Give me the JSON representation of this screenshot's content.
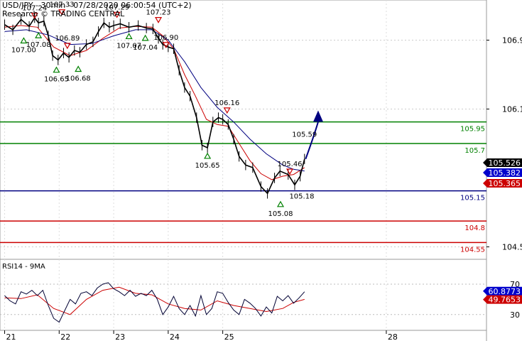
{
  "header": {
    "line1": "USD/JPY - 30min - 07/28/2020 06:00:54 (UTC+2)",
    "line2": "Research © TRADING CENTRAL"
  },
  "chart_data": [
    {
      "type": "line",
      "title": "USD/JPY - 30min - 07/28/2020 06:00:54 (UTC+2)",
      "price_axis": {
        "range": [
          104.38,
          107.3
        ],
        "ticks": [
          "106.9",
          "106.1",
          "104.5"
        ]
      },
      "time_axis": {
        "range": [
          20.98,
          28.6
        ],
        "ticks": [
          {
            "x": 21,
            "label": "21"
          },
          {
            "x": 22,
            "label": "22"
          },
          {
            "x": 23,
            "label": "23"
          },
          {
            "x": 24,
            "label": "24"
          },
          {
            "x": 25,
            "label": "25"
          },
          {
            "x": 28,
            "label": "28"
          }
        ]
      },
      "price_series": {
        "x": [
          21.0,
          21.15,
          21.3,
          21.45,
          21.55,
          21.62,
          21.72,
          21.8,
          21.88,
          21.98,
          22.08,
          22.18,
          22.28,
          22.38,
          22.5,
          22.62,
          22.72,
          22.82,
          22.92,
          23.0,
          23.12,
          23.28,
          23.45,
          23.6,
          23.72,
          23.82,
          23.9,
          24.0,
          24.1,
          24.2,
          24.3,
          24.4,
          24.52,
          24.62,
          24.72,
          24.82,
          24.92,
          25.0,
          25.1,
          25.2,
          25.3,
          25.42,
          25.55,
          25.7,
          25.82,
          25.95,
          26.05,
          26.2,
          26.32,
          26.42,
          26.5
        ],
        "y": [
          107.08,
          107.02,
          107.14,
          107.06,
          107.16,
          107.1,
          107.12,
          106.95,
          106.72,
          106.67,
          106.75,
          106.7,
          106.78,
          106.76,
          106.85,
          106.88,
          107.0,
          107.1,
          107.05,
          107.07,
          107.09,
          107.05,
          107.07,
          107.04,
          107.03,
          106.92,
          106.85,
          106.82,
          106.8,
          106.55,
          106.35,
          106.25,
          106.0,
          105.68,
          105.65,
          105.95,
          106.0,
          105.98,
          105.92,
          105.75,
          105.55,
          105.45,
          105.42,
          105.2,
          105.12,
          105.3,
          105.38,
          105.34,
          105.22,
          105.32,
          105.52
        ]
      },
      "moving_averages": [
        {
          "color": "#cc0000",
          "x": [
            21.0,
            21.3,
            21.6,
            21.9,
            22.2,
            22.5,
            22.8,
            23.1,
            23.4,
            23.7,
            23.9,
            24.1,
            24.3,
            24.5,
            24.7,
            24.9,
            25.1,
            25.3,
            25.5,
            25.7,
            25.9,
            26.1,
            26.3,
            26.5
          ],
          "y": [
            107.05,
            107.07,
            107.05,
            106.82,
            106.72,
            106.78,
            106.92,
            107.04,
            107.06,
            107.05,
            106.95,
            106.8,
            106.5,
            106.25,
            105.98,
            105.92,
            105.9,
            105.7,
            105.5,
            105.35,
            105.28,
            105.32,
            105.34,
            105.42
          ]
        },
        {
          "color": "#000080",
          "x": [
            21.0,
            21.4,
            21.8,
            22.2,
            22.6,
            23.0,
            23.4,
            23.7,
            24.0,
            24.3,
            24.6,
            24.9,
            25.2,
            25.5,
            25.8,
            26.1,
            26.3,
            26.5
          ],
          "y": [
            107.0,
            107.02,
            106.96,
            106.85,
            106.86,
            106.95,
            107.02,
            107.02,
            106.9,
            106.65,
            106.35,
            106.12,
            105.95,
            105.75,
            105.58,
            105.45,
            105.4,
            105.38
          ]
        }
      ],
      "forecast_arrow": {
        "from": [
          26.52,
          105.52
        ],
        "to": [
          26.75,
          106.05
        ],
        "color": "#000080"
      },
      "levels": [
        {
          "value": 105.95,
          "label": "105.95",
          "color": "#008000"
        },
        {
          "value": 105.7,
          "label": "105.7",
          "color": "#008000"
        },
        {
          "value": 105.15,
          "label": "105.15",
          "color": "#000080"
        },
        {
          "value": 104.8,
          "label": "104.8",
          "color": "#cc0000"
        },
        {
          "value": 104.55,
          "label": "104.55",
          "color": "#cc0000"
        }
      ],
      "price_badges": [
        {
          "value": 105.526,
          "label": "105.526",
          "bg": "#000000",
          "fg": "#ffffff"
        },
        {
          "value": 105.382,
          "label": "105.382",
          "bg": "#0000cc",
          "fg": "#ffffff"
        },
        {
          "value": 105.365,
          "label": "105.365",
          "bg": "#cc0000",
          "fg": "#ffffff"
        }
      ],
      "annotations": [
        {
          "x": 21.55,
          "y": 107.18,
          "label": "107.24",
          "kind": "high"
        },
        {
          "x": 22.05,
          "y": 107.22,
          "label": "107.33",
          "kind": "high"
        },
        {
          "x": 23.06,
          "y": 107.19,
          "label": "107.29",
          "kind": "high"
        },
        {
          "x": 23.82,
          "y": 107.13,
          "label": "107.23",
          "kind": "high"
        },
        {
          "x": 22.15,
          "y": 106.83,
          "label": "106.89",
          "kind": "high"
        },
        {
          "x": 23.96,
          "y": 106.84,
          "label": "106.90",
          "kind": "high"
        },
        {
          "x": 25.08,
          "y": 106.08,
          "label": "106.16",
          "kind": "high"
        },
        {
          "x": 26.23,
          "y": 105.37,
          "label": "105.46",
          "kind": "high"
        },
        {
          "x": 21.35,
          "y": 106.9,
          "label": "107.00",
          "kind": "low"
        },
        {
          "x": 21.62,
          "y": 106.96,
          "label": "107.08",
          "kind": "low"
        },
        {
          "x": 21.95,
          "y": 106.56,
          "label": "106.65",
          "kind": "low"
        },
        {
          "x": 22.35,
          "y": 106.57,
          "label": "106.68",
          "kind": "low"
        },
        {
          "x": 23.28,
          "y": 106.95,
          "label": "107.07",
          "kind": "low"
        },
        {
          "x": 23.58,
          "y": 106.93,
          "label": "107.04",
          "kind": "low"
        },
        {
          "x": 24.72,
          "y": 105.56,
          "label": "105.65",
          "kind": "low"
        },
        {
          "x": 26.06,
          "y": 105.0,
          "label": "105.08",
          "kind": "low"
        }
      ],
      "free_labels": [
        {
          "x": 26.5,
          "y": 105.78,
          "label": "105.59"
        },
        {
          "x": 26.45,
          "y": 105.06,
          "label": "105.18"
        }
      ]
    },
    {
      "type": "line",
      "title": "RSI14 - 9MA",
      "ylim": [
        12,
        100
      ],
      "y_ticks": [
        "70",
        "30"
      ],
      "rsi": {
        "x": [
          21.0,
          21.1,
          21.2,
          21.3,
          21.4,
          21.5,
          21.6,
          21.7,
          21.8,
          21.9,
          22.0,
          22.1,
          22.2,
          22.3,
          22.4,
          22.5,
          22.6,
          22.7,
          22.8,
          22.9,
          23.0,
          23.1,
          23.2,
          23.3,
          23.4,
          23.5,
          23.6,
          23.7,
          23.8,
          23.9,
          24.0,
          24.1,
          24.2,
          24.3,
          24.4,
          24.5,
          24.6,
          24.7,
          24.8,
          24.9,
          25.0,
          25.1,
          25.2,
          25.3,
          25.4,
          25.5,
          25.6,
          25.7,
          25.8,
          25.9,
          26.0,
          26.1,
          26.2,
          26.3,
          26.4,
          26.5
        ],
        "y": [
          55,
          48,
          44,
          60,
          57,
          62,
          55,
          62,
          42,
          25,
          20,
          35,
          50,
          44,
          58,
          60,
          55,
          65,
          70,
          72,
          64,
          60,
          55,
          62,
          54,
          58,
          55,
          62,
          50,
          30,
          40,
          54,
          38,
          30,
          42,
          28,
          55,
          30,
          38,
          60,
          58,
          46,
          36,
          30,
          50,
          45,
          38,
          28,
          40,
          32,
          54,
          48,
          55,
          45,
          52,
          60
        ]
      },
      "ma9": {
        "x": [
          21.0,
          21.3,
          21.6,
          21.9,
          22.2,
          22.5,
          22.8,
          23.1,
          23.4,
          23.7,
          24.0,
          24.3,
          24.6,
          24.9,
          25.2,
          25.5,
          25.8,
          26.1,
          26.3,
          26.5
        ],
        "y": [
          52,
          51,
          56,
          38,
          30,
          50,
          62,
          66,
          58,
          56,
          44,
          38,
          36,
          48,
          42,
          38,
          34,
          38,
          46,
          50
        ]
      },
      "badges": [
        {
          "value": 60.8773,
          "label": "60.8773",
          "bg": "#0000cc",
          "fg": "#ffffff"
        },
        {
          "value": 49.7653,
          "label": "49.7653",
          "bg": "#cc0000",
          "fg": "#ffffff"
        }
      ]
    }
  ]
}
